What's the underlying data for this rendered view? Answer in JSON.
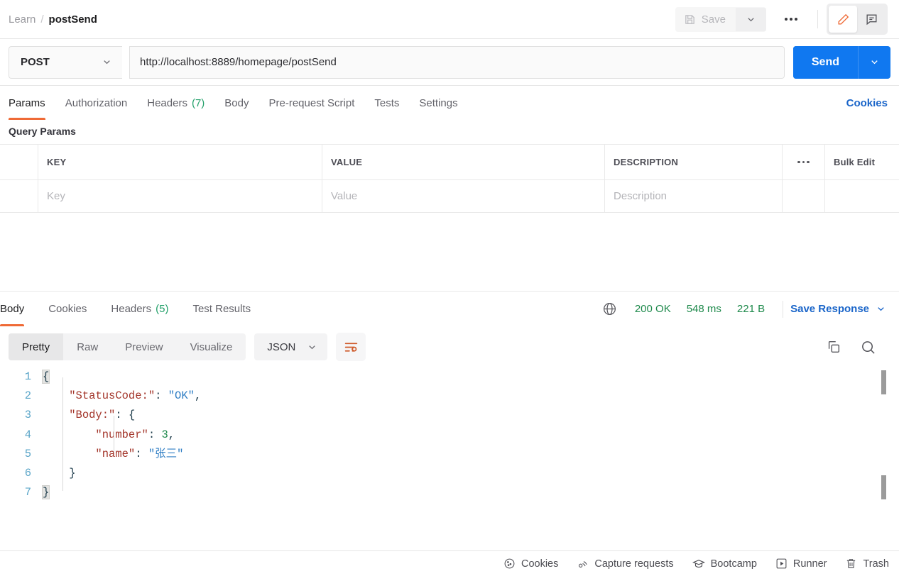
{
  "header": {
    "breadcrumb": {
      "collection": "Learn",
      "separator": "/",
      "request_name": "postSend"
    },
    "save_label": "Save",
    "icons": {
      "save": "floppy-disk-icon",
      "save_caret": "chevron-down-icon",
      "more": "ellipsis-icon",
      "edit": "pencil-icon",
      "comment": "comment-icon"
    }
  },
  "request": {
    "method": "POST",
    "url": "http://localhost:8889/homepage/postSend",
    "send_label": "Send",
    "tabs": [
      {
        "label": "Params",
        "count": "",
        "active": true
      },
      {
        "label": "Authorization",
        "count": "",
        "active": false
      },
      {
        "label": "Headers",
        "count": "(7)",
        "active": false
      },
      {
        "label": "Body",
        "count": "",
        "active": false
      },
      {
        "label": "Pre-request Script",
        "count": "",
        "active": false
      },
      {
        "label": "Tests",
        "count": "",
        "active": false
      },
      {
        "label": "Settings",
        "count": "",
        "active": false
      }
    ],
    "cookies_link": "Cookies",
    "query_params": {
      "section_title": "Query Params",
      "columns": [
        "KEY",
        "VALUE",
        "DESCRIPTION"
      ],
      "bulk_edit_label": "Bulk Edit",
      "rows": [
        {
          "key": "",
          "value": "",
          "description": ""
        }
      ],
      "placeholders": {
        "key": "Key",
        "value": "Value",
        "description": "Description"
      }
    }
  },
  "response": {
    "tabs": [
      {
        "label": "Body",
        "count": "",
        "active": true
      },
      {
        "label": "Cookies",
        "count": "",
        "active": false
      },
      {
        "label": "Headers",
        "count": "(5)",
        "active": false
      },
      {
        "label": "Test Results",
        "count": "",
        "active": false
      }
    ],
    "status": {
      "code": "200 OK",
      "time": "548 ms",
      "size": "221 B"
    },
    "save_response_label": "Save Response",
    "viewer": {
      "modes": [
        {
          "label": "Pretty",
          "active": true
        },
        {
          "label": "Raw",
          "active": false
        },
        {
          "label": "Preview",
          "active": false
        },
        {
          "label": "Visualize",
          "active": false
        }
      ],
      "format": "JSON",
      "icons": {
        "wrap": "word-wrap-icon",
        "copy": "copy-icon",
        "search": "search-icon",
        "globe": "globe-icon"
      }
    },
    "body_lines": [
      {
        "n": "1",
        "segments": [
          {
            "t": "{",
            "c": "tok-punc brace-hl"
          }
        ]
      },
      {
        "n": "2",
        "segments": [
          {
            "t": "    ",
            "c": ""
          },
          {
            "t": "\"StatusCode:\"",
            "c": "tok-key"
          },
          {
            "t": ": ",
            "c": "tok-punc"
          },
          {
            "t": "\"OK\"",
            "c": "tok-str"
          },
          {
            "t": ",",
            "c": "tok-punc"
          }
        ]
      },
      {
        "n": "3",
        "segments": [
          {
            "t": "    ",
            "c": ""
          },
          {
            "t": "\"Body:\"",
            "c": "tok-key"
          },
          {
            "t": ": ",
            "c": "tok-punc"
          },
          {
            "t": "{",
            "c": "tok-punc"
          }
        ]
      },
      {
        "n": "4",
        "segments": [
          {
            "t": "        ",
            "c": ""
          },
          {
            "t": "\"number\"",
            "c": "tok-key"
          },
          {
            "t": ": ",
            "c": "tok-punc"
          },
          {
            "t": "3",
            "c": "tok-num"
          },
          {
            "t": ",",
            "c": "tok-punc"
          }
        ]
      },
      {
        "n": "5",
        "segments": [
          {
            "t": "        ",
            "c": ""
          },
          {
            "t": "\"name\"",
            "c": "tok-key"
          },
          {
            "t": ": ",
            "c": "tok-punc"
          },
          {
            "t": "\"张三\"",
            "c": "tok-str"
          }
        ]
      },
      {
        "n": "6",
        "segments": [
          {
            "t": "    ",
            "c": ""
          },
          {
            "t": "}",
            "c": "tok-punc"
          }
        ]
      },
      {
        "n": "7",
        "segments": [
          {
            "t": "}",
            "c": "tok-punc brace-hl"
          }
        ]
      }
    ]
  },
  "footer": {
    "items": [
      {
        "label": "Cookies",
        "icon": "cookie-icon"
      },
      {
        "label": "Capture requests",
        "icon": "satellite-icon"
      },
      {
        "label": "Bootcamp",
        "icon": "graduation-cap-icon"
      },
      {
        "label": "Runner",
        "icon": "play-box-icon"
      },
      {
        "label": "Trash",
        "icon": "trash-icon"
      }
    ]
  },
  "colors": {
    "accent_orange": "#ef6a36",
    "send_blue": "#1078f0",
    "link_blue": "#1a65c9",
    "status_green": "#1f8a4c"
  }
}
